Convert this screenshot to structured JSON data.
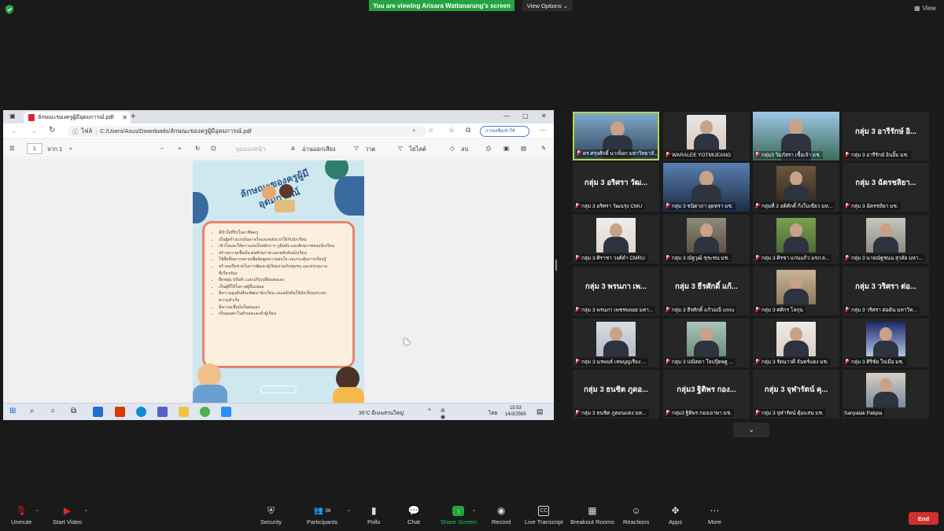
{
  "banner": {
    "viewing": "You are viewing Arisara Wattanarung's screen",
    "view_options": "View Options ⌄",
    "view": "View"
  },
  "browser": {
    "tab_title": "ลักษณะของครูผู้มีอุดมการณ์.pdf",
    "file_label": "ไฟล์",
    "address": "C:/Users/Asus/Downloads/ลักษณะของครูผู้มีอุดมการณ์.pdf",
    "sync_label": "การลงชื่อเข้าใช้",
    "page_number": "1",
    "page_of": "จาก 1",
    "page_view": "มุมมองหน้า",
    "read_aloud": "อ่านออกเสียง",
    "draw": "วาด",
    "highlight": "ไฮไลต์",
    "erase": "ลบ"
  },
  "document": {
    "title": "ลักษณะของครูผู้มีอุดมการณ์",
    "bullets": [
      "มีหัวใจที่รักในอาชีพครู",
      "เป็นผู้สร้างแรงบันดาลใจและพลังบวกให้กับนักเรียน",
      "เข้าใจและให้ความสนใจหลักการ ภูมิหลัง และศักยภาพของนักเรียน",
      "สร้างความเชื่อมั่น ต่อศักยภาพ และพลักดันนักเรียน",
      "ใช้สื่อที่หลากหลายเพื่อจัดดูดความสนใจ และกระตุ้นการเรียนรู้",
      "สร้างเครือข่ายในการพัฒนาผู้เรียนร่วมกับชุมชน และหน่วยงาน",
      "ที่เกี่ยวข้อง",
      "ยืดหยุ่น ปรับตัว และปรับเปลี่ยนตนเอง",
      "เป็นผู้ที่ให้โอกาสผู้อื่นเสมอ",
      "มีความมุ่งมั่นที่จะพัฒนานักเรียน และผลักดันให้นักเรียนประสบ",
      "ความสำเร็จ",
      "มีความเชื่อมั่นในตนเอง",
      "เห็นคุณค่าในตัวเองและตัวผู้เรียน"
    ]
  },
  "taskbar": {
    "weather": "35°C มีเมฆส่วนใหญ่",
    "lang": "ไทย",
    "time": "15:53",
    "date": "14/3/2565"
  },
  "participants": [
    {
      "top": "",
      "label": "ดร.ศรุงศักดิ์ นาเพ็อก มหาวิทยาลั...",
      "type": "video",
      "active": true
    },
    {
      "top": "",
      "label": "WARALEE YOTMUEANG",
      "type": "video"
    },
    {
      "top": "",
      "label": "กลุ่ม3 วิมภัสรา เชื้อเจ้า มช.",
      "type": "video"
    },
    {
      "top": "กลุ่ม 3 อารีรักษ์ อิ...",
      "label": "กลุ่ม 3 อารีรักษ์ อินอิ้ม มช.",
      "type": "name"
    },
    {
      "top": "กลุ่ม 3 อริศรา วัฒ...",
      "label": "กลุ่ม 3 อริศรา วัฒนรุ่ง CMU",
      "type": "name"
    },
    {
      "top": "",
      "label": "กลุ่ม 3 ชนิตาภา อุดทรา มช.",
      "type": "video"
    },
    {
      "top": "",
      "label": "กลุ่มที่ 3 อดิศักดิ์ กิ่งใบเขียว มห...",
      "type": "video"
    },
    {
      "top": "กลุ่ม 3 ฉัตรชลิยา...",
      "label": "กลุ่ม 3 ฉัตรชลิยา มช.",
      "type": "name"
    },
    {
      "top": "",
      "label": "กลุ่ม 3 ศิราชา วงศ์คำ CMRU",
      "type": "video"
    },
    {
      "top": "",
      "label": "กลุ่ม 3 ณัฐวุฒิ ขุระชน มช.",
      "type": "video"
    },
    {
      "top": "",
      "label": "กลุ่ม 3 ศิรชา แก่นแก้ว มรภ.ล...",
      "type": "video"
    },
    {
      "top": "",
      "label": "กลุ่ม 3 นายณัฐชนน สุวลัย มหา...",
      "type": "video"
    },
    {
      "top": "กลุ่ม 3 พรนภา เพ...",
      "label": "กลุ่ม 3 พรนภา เพชรพลอย มหา...",
      "type": "name"
    },
    {
      "top": "กลุ่ม 3 ธีรศักดิ์ แก้...",
      "label": "กลุ่ม 3 ธีรศักดิ์ แก้วมณี cmru",
      "type": "name"
    },
    {
      "top": "",
      "label": "กลุ่ม 3 ศศิกร โลกุน",
      "type": "video"
    },
    {
      "top": "กลุ่ม 3 วริศรา ต่อ...",
      "label": "กลุ่ม 3 วริศรา ต่อต้น มหาวิท...",
      "type": "name"
    },
    {
      "top": "",
      "label": "กลุ่ม 3 นรพนธ์ เทพบุญเรือง ...",
      "type": "video"
    },
    {
      "top": "",
      "label": "กลุ่ม 3 ปณิตตา ใจบปุ๊ดพฐ ...",
      "type": "video"
    },
    {
      "top": "",
      "label": "กลุ่ม 3 รัตนาวดี จันทร์แดง มช.",
      "type": "video"
    },
    {
      "top": "",
      "label": "กลุ่ม 3 ศิริชัย ใจเมือ มช.",
      "type": "video"
    },
    {
      "top": "กลุ่ม 3 ธนชิต ภูดอ...",
      "label": "กลุ่ม 3 ธนชิต ภูดอนแดง มห...",
      "type": "name"
    },
    {
      "top": "กลุ่ม3 ฐิติพร กอง...",
      "label": "กลุ่ม3 ฐิติพร กองเอาษา มช.",
      "type": "name"
    },
    {
      "top": "กลุ่ม 3 จุฬารัตน์ คุ...",
      "label": "กลุ่ม 3 จุฬารัตน์ คุ้มแสน มช.",
      "type": "name"
    },
    {
      "top": "",
      "label": "Sanyalak Pakpia",
      "type": "video",
      "nomute": true
    }
  ],
  "toolbar": {
    "unmute": "Unmute",
    "start_video": "Start Video",
    "security": "Security",
    "participants": "Participants",
    "participants_count": "36",
    "polls": "Polls",
    "chat": "Chat",
    "share_screen": "Share Screen",
    "record": "Record",
    "live_transcript": "Live Transcript",
    "breakout_rooms": "Breakout Rooms",
    "reactions": "Reactions",
    "apps": "Apps",
    "more": "More",
    "end": "End"
  },
  "colors": {
    "share_green": "#23a443",
    "active_speaker": "#b6d44a",
    "end_red": "#d32f2f",
    "mute_red": "#e0262b"
  }
}
